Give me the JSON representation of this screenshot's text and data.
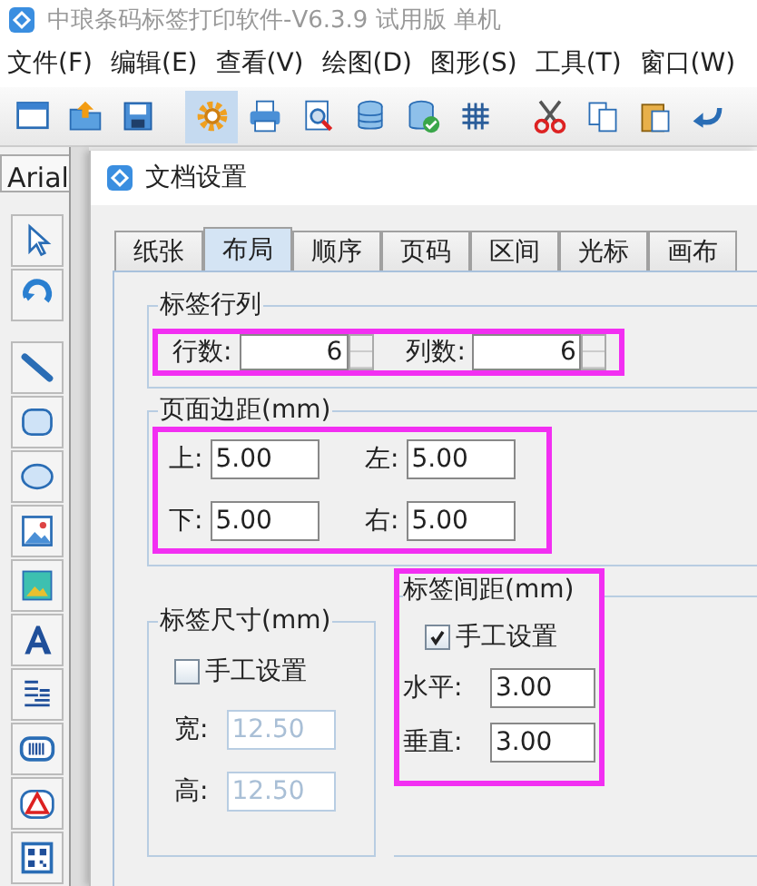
{
  "window": {
    "title": "中琅条码标签打印软件-V6.3.9 试用版 单机"
  },
  "menu": [
    "文件(F)",
    "编辑(E)",
    "查看(V)",
    "绘图(D)",
    "图形(S)",
    "工具(T)",
    "窗口(W)"
  ],
  "toolbar": [
    {
      "selected": false
    },
    {
      "selected": false
    },
    {
      "selected": false
    },
    {
      "selected": true
    },
    {
      "selected": false
    },
    {
      "selected": false
    },
    {
      "selected": false
    },
    {
      "selected": false
    },
    {
      "selected": false
    },
    {
      "selected": false
    },
    {
      "selected": false
    },
    {
      "selected": false
    },
    {
      "selected": false
    }
  ],
  "font_field": {
    "value": "Arial"
  },
  "dialog": {
    "title": "文档设置",
    "tabs": [
      {
        "label": "纸张",
        "selected": false
      },
      {
        "label": "布局",
        "selected": true
      },
      {
        "label": "顺序",
        "selected": false
      },
      {
        "label": "页码",
        "selected": false
      },
      {
        "label": "区间",
        "selected": false
      },
      {
        "label": "光标",
        "selected": false
      },
      {
        "label": "画布",
        "selected": false
      }
    ],
    "rows_cols": {
      "title": "标签行列",
      "fields": [
        {
          "label": "行数:",
          "value": "6"
        },
        {
          "label": "列数:",
          "value": "6"
        }
      ]
    },
    "margins": {
      "title": "页面边距(mm)",
      "fields": [
        {
          "label": "上:",
          "value": "5.00"
        },
        {
          "label": "左:",
          "value": "5.00"
        },
        {
          "label": "下:",
          "value": "5.00"
        },
        {
          "label": "右:",
          "value": "5.00"
        }
      ]
    },
    "label_size": {
      "title": "标签尺寸(mm)",
      "manual": {
        "label": "手工设置",
        "checked": false
      },
      "fields": [
        {
          "label": "宽:",
          "value": "12.50"
        },
        {
          "label": "高:",
          "value": "12.50"
        }
      ]
    },
    "label_gap": {
      "title": "标签间距(mm)",
      "manual": {
        "label": "手工设置",
        "checked": true
      },
      "fields": [
        {
          "label": "水平:",
          "value": "3.00"
        },
        {
          "label": "垂直:",
          "value": "3.00"
        }
      ]
    }
  }
}
